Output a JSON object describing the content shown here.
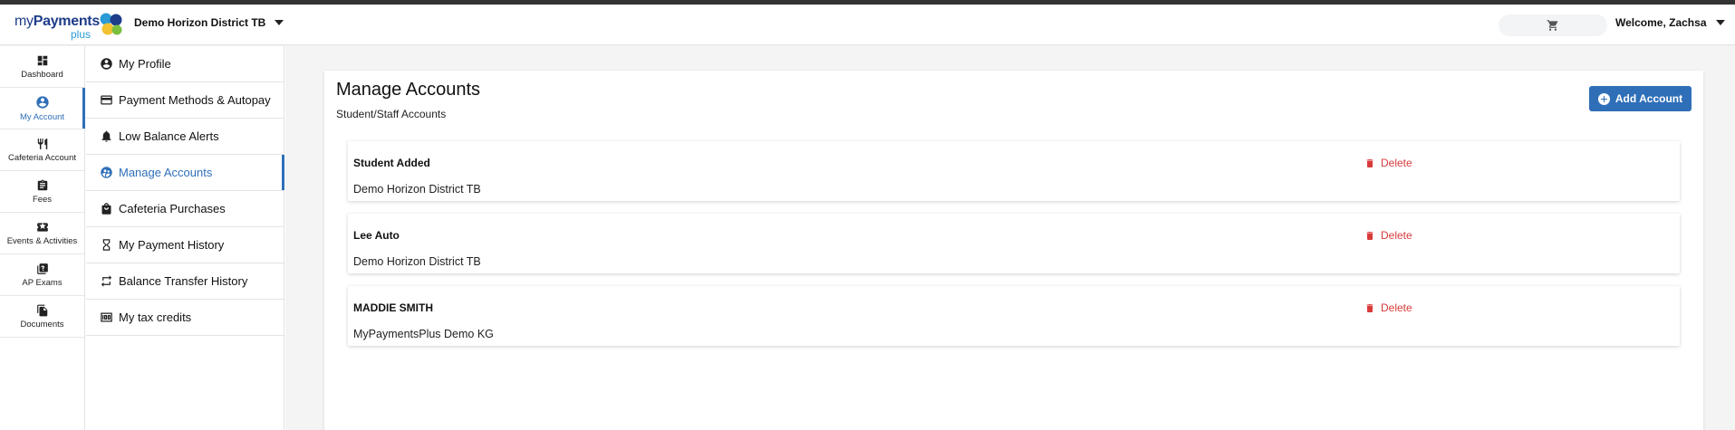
{
  "header": {
    "logo": {
      "text_my": "my",
      "text_payments": "Payments",
      "text_plus": "plus"
    },
    "district": "Demo Horizon District TB",
    "welcome": "Welcome, Zachsa",
    "icons": {
      "cart": "shopping-cart-icon",
      "dropdown": "caret-down-icon"
    }
  },
  "rail": {
    "items": [
      {
        "label": "Dashboard",
        "icon": "dashboard-icon"
      },
      {
        "label": "My Account",
        "icon": "account-circle-icon",
        "active": true
      },
      {
        "label": "Cafeteria Account",
        "icon": "fork-knife-icon"
      },
      {
        "label": "Fees",
        "icon": "clipboard-icon"
      },
      {
        "label": "Events & Activities",
        "icon": "ticket-icon"
      },
      {
        "label": "AP Exams",
        "icon": "quiz-icon"
      },
      {
        "label": "Documents",
        "icon": "documents-icon"
      }
    ]
  },
  "subnav": {
    "items": [
      {
        "label": "My Profile",
        "icon": "profile-circle-icon"
      },
      {
        "label": "Payment Methods & Autopay",
        "icon": "credit-card-icon"
      },
      {
        "label": "Low Balance Alerts",
        "icon": "bell-icon"
      },
      {
        "label": "Manage Accounts",
        "icon": "manage-accounts-icon",
        "active": true
      },
      {
        "label": "Cafeteria Purchases",
        "icon": "shopping-bag-icon"
      },
      {
        "label": "My Payment History",
        "icon": "hourglass-icon"
      },
      {
        "label": "Balance Transfer History",
        "icon": "transfer-arrows-icon"
      },
      {
        "label": "My tax credits",
        "icon": "money-icon"
      }
    ]
  },
  "main": {
    "title": "Manage Accounts",
    "subtitle": "Student/Staff Accounts",
    "add_button": "Add Account",
    "accounts": [
      {
        "name": "Student Added",
        "district": "Demo Horizon District TB",
        "delete_label": "Delete"
      },
      {
        "name": "Lee Auto",
        "district": "Demo Horizon District TB",
        "delete_label": "Delete"
      },
      {
        "name": "MADDIE SMITH",
        "district": "MyPaymentsPlus Demo KG",
        "delete_label": "Delete"
      }
    ]
  },
  "colors": {
    "accent": "#2f6fb8",
    "danger": "#d93a3a",
    "topbar": "#333333"
  }
}
